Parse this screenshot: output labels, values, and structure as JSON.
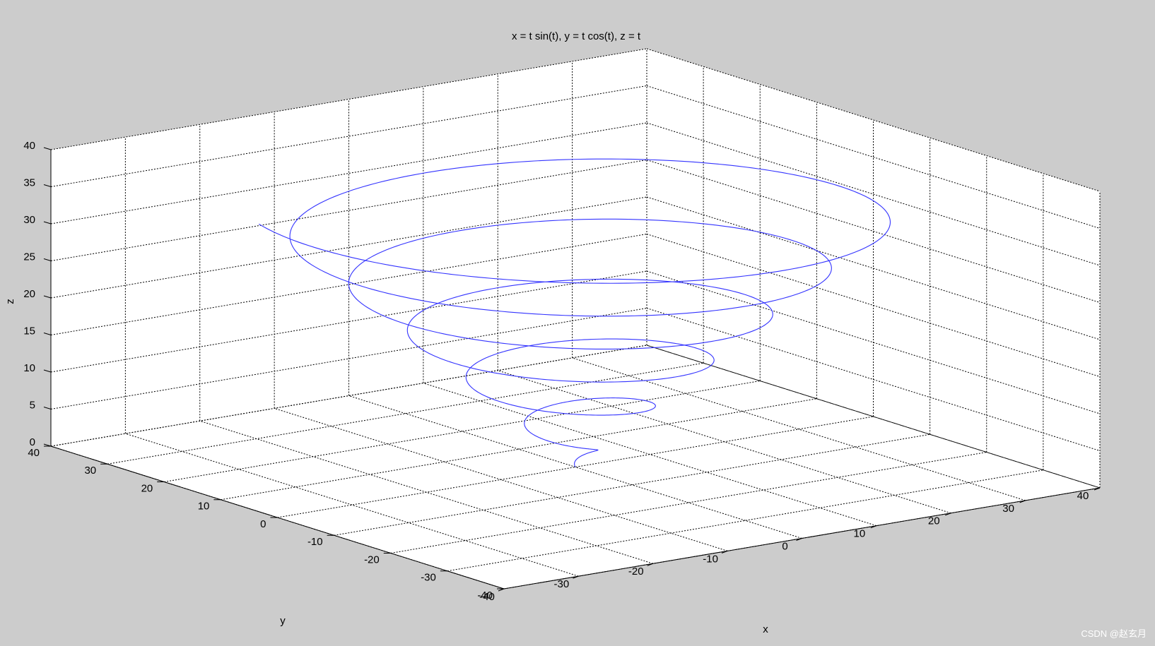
{
  "chart_data": {
    "type": "line3d",
    "title": "x = t sin(t), y = t cos(t), z = t",
    "xlabel": "x",
    "ylabel": "y",
    "zlabel": "z",
    "xlim": [
      -40,
      40
    ],
    "ylim": [
      -40,
      40
    ],
    "zlim": [
      0,
      40
    ],
    "xticks": [
      -40,
      -30,
      -20,
      -10,
      0,
      10,
      20,
      30,
      40
    ],
    "yticks": [
      -40,
      -30,
      -20,
      -10,
      0,
      10,
      20,
      30,
      40
    ],
    "zticks": [
      0,
      5,
      10,
      15,
      20,
      25,
      30,
      35,
      40
    ],
    "grid": true,
    "view": "default 3-D (azimuth -37.5, elevation 30)",
    "series": [
      {
        "color": "#3333ff",
        "x_expr": "t sin(t)",
        "y_expr": "t cos(t)",
        "z_expr": "t",
        "t_range": [
          0,
          36.4
        ]
      }
    ]
  },
  "watermark": "CSDN @赵玄月",
  "colors": {
    "figure_background": "#cccccc",
    "axes_background": "#ffffff",
    "line": "#3333ff",
    "grid": "#000000"
  }
}
